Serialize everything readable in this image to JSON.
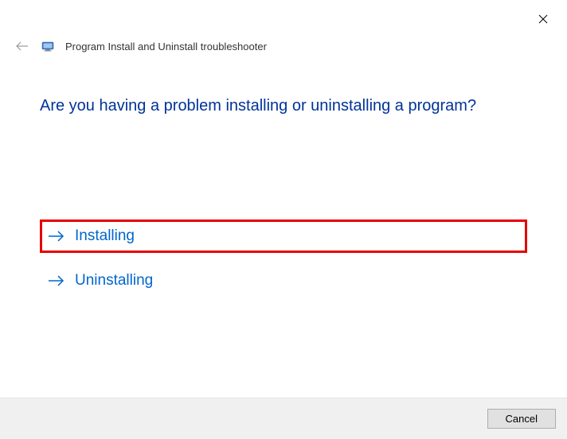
{
  "header": {
    "title": "Program Install and Uninstall troubleshooter"
  },
  "main": {
    "question": "Are you having a problem installing or uninstalling a program?",
    "options": [
      {
        "label": "Installing",
        "highlighted": true
      },
      {
        "label": "Uninstalling",
        "highlighted": false
      }
    ]
  },
  "footer": {
    "cancel_label": "Cancel"
  }
}
